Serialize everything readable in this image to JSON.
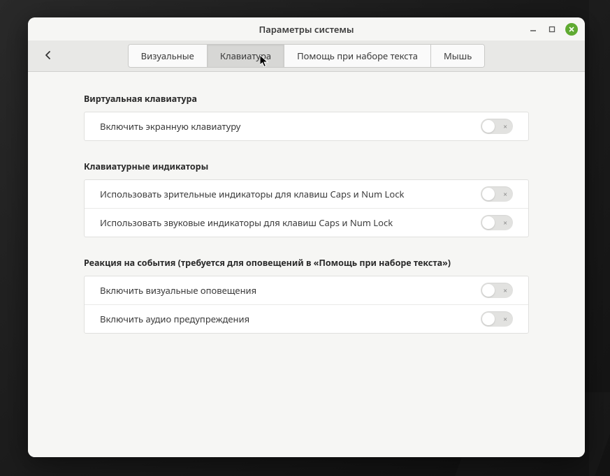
{
  "window": {
    "title": "Параметры системы"
  },
  "tabs": {
    "visual": "Визуальные",
    "keyboard": "Клавиатура",
    "typing_assist": "Помощь при наборе текста",
    "mouse": "Мышь"
  },
  "sections": {
    "virtual_keyboard": {
      "title": "Виртуальная клавиатура",
      "enable_onscreen": "Включить экранную клавиатуру"
    },
    "keyboard_indicators": {
      "title": "Клавиатурные индикаторы",
      "visual_caps_num": "Использовать зрительные индикаторы для клавиш Caps и Num Lock",
      "audio_caps_num": "Использовать звуковые индикаторы для клавиш Caps и Num Lock"
    },
    "event_alerts": {
      "title": "Реакция на события (требуется для оповещений в «Помощь при наборе текста»)",
      "visual_alerts": "Включить визуальные оповещения",
      "audio_alerts": "Включить аудио предупреждения"
    }
  },
  "toggle_off_glyph": "×"
}
